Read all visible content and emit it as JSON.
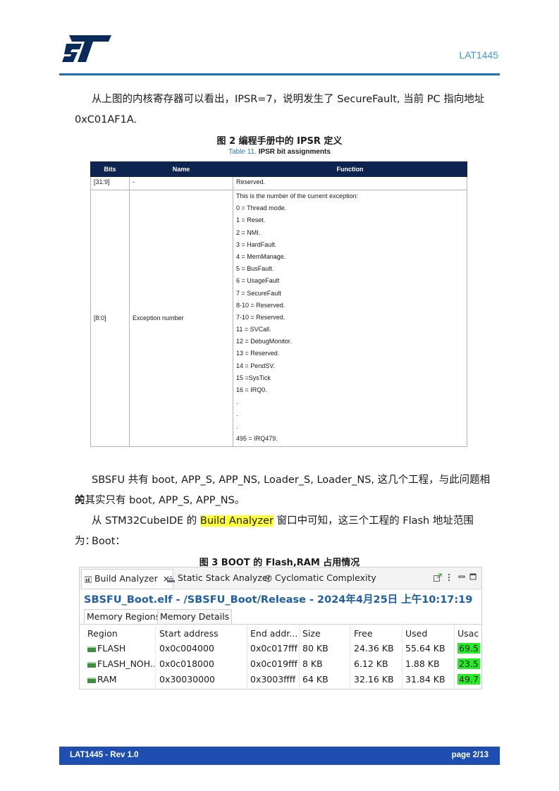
{
  "header": {
    "doc_code": "LAT1445"
  },
  "intro": {
    "line1": "从上图的内核寄存器可以看出，IPSR=7，说明发生了 SecureFault, 当前 PC 指向地址",
    "line2": "0xC01AF1A."
  },
  "figure2": {
    "caption": "图 2 编程手册中的 IPSR 定义",
    "table_num": "Table 11.",
    "table_title": "IPSR bit assignments",
    "columns": [
      "Bits",
      "Name",
      "Function"
    ],
    "row1": {
      "bits": "[31:9]",
      "name": "-",
      "function": "Reserved."
    },
    "row2": {
      "bits": "[8:0]",
      "name": "Exception number",
      "function_lines": [
        "This is the number of the current exception:",
        "0 = Thread mode.",
        "1 = Reset.",
        "2 = NMI.",
        "3 = HardFault.",
        "4 = MemManage.",
        "5 = BusFault.",
        "6 = UsageFault",
        "7 = SecureFault",
        "8-10 = Reserved.",
        "7-10 = Reserved.",
        "11 = SVCall.",
        "12 = DebugMonitor.",
        "13 = Reserved.",
        "14 = PendSV.",
        "15 =SysTick",
        "16 = IRQ0.",
        ".",
        ".",
        ".",
        "495 = IRQ479."
      ]
    }
  },
  "body": {
    "p1_line1": "SBSFU 共有 boot, APP_S, APP_NS, Loader_S, Loader_NS, 这几个工程，与此问题相关",
    "p1_line2": "的其实只有 boot, APP_S, APP_NS。",
    "p2_before": "从 STM32CubeIDE 的 ",
    "p2_highlight": "Build Analyzer",
    "p2_after": " 窗口中可知，这三个工程的 Flash 地址范围为：",
    "p3": "Boot："
  },
  "figure3": {
    "caption": "图 3 BOOT 的 Flash,RAM 占用情况",
    "tabs": [
      "Build Analyzer",
      "Static Stack Analyzer",
      "Cyclomatic Complexity"
    ],
    "title": "SBSFU_Boot.elf - /SBSFU_Boot/Release - 2024年4月25日 上午10:17:19",
    "sub_tabs": [
      "Memory Regions",
      "Memory Details"
    ],
    "columns": [
      "Region",
      "Start address",
      "End addr...",
      "Size",
      "Free",
      "Used",
      "Usac"
    ],
    "rows": [
      {
        "region": "FLASH",
        "start": "0x0c004000",
        "end": "0x0c017fff",
        "size": "80 KB",
        "free": "24.36 KB",
        "used": "55.64 KB",
        "usage": "69.5"
      },
      {
        "region": "FLASH_NOH...",
        "start": "0x0c018000",
        "end": "0x0c019fff",
        "size": "8 KB",
        "free": "6.12 KB",
        "used": "1.88 KB",
        "usage": "23.5"
      },
      {
        "region": "RAM",
        "start": "0x30030000",
        "end": "0x3003ffff",
        "size": "64 KB",
        "free": "32.16 KB",
        "used": "31.84 KB",
        "usage": "49.7"
      }
    ]
  },
  "footer": {
    "left": "LAT1445  - Rev 1.0",
    "right": "page 2/13"
  },
  "colors": {
    "brand_blue": "#1e6fb5",
    "table_header": "#0d2350",
    "footer_bg": "#1e4fb0",
    "highlight": "#ffff33",
    "usage_green": "#22ee22"
  }
}
